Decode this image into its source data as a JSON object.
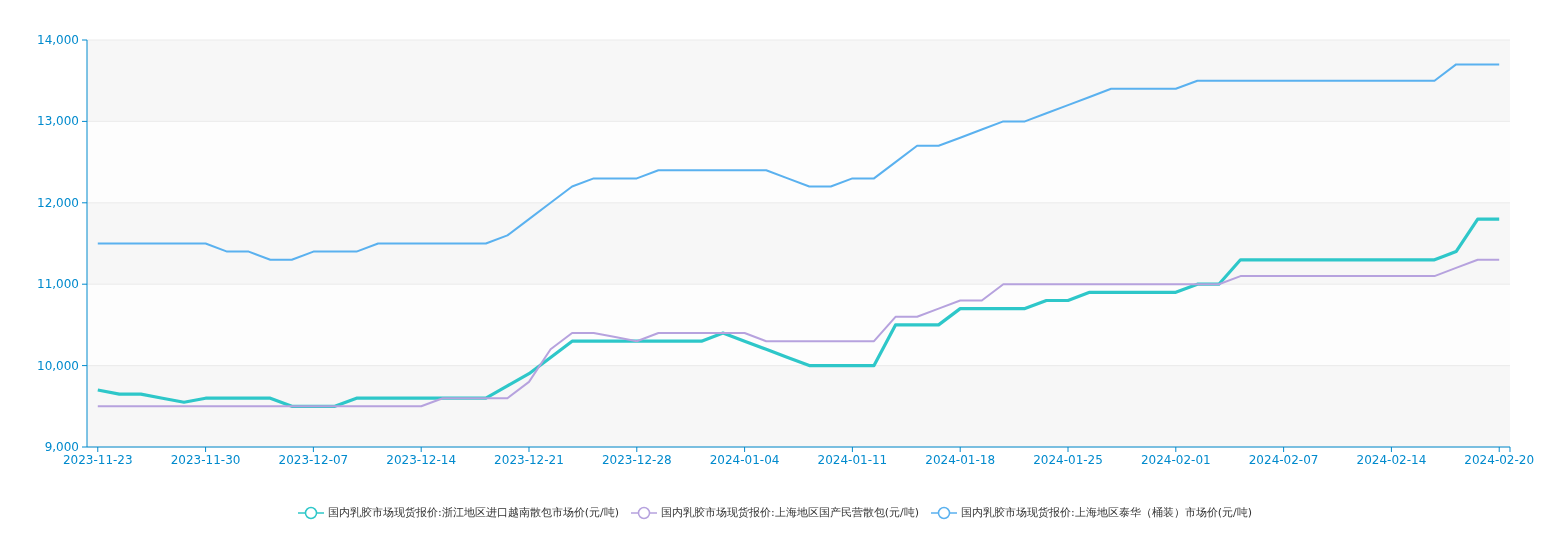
{
  "chart": {
    "chart_data": {
      "type": "line",
      "grid": true,
      "categories": [
        "2023-11-23",
        null,
        null,
        null,
        null,
        "2023-11-30",
        null,
        null,
        null,
        null,
        "2023-12-07",
        null,
        null,
        null,
        null,
        "2023-12-14",
        null,
        null,
        null,
        null,
        "2023-12-21",
        null,
        null,
        null,
        null,
        "2023-12-28",
        null,
        null,
        null,
        null,
        "2024-01-04",
        null,
        null,
        null,
        null,
        "2024-01-11",
        null,
        null,
        null,
        null,
        "2024-01-18",
        null,
        null,
        null,
        null,
        "2024-01-25",
        null,
        null,
        null,
        null,
        "2024-02-01",
        null,
        null,
        null,
        null,
        "2024-02-07",
        null,
        null,
        null,
        null,
        "2024-02-14",
        null,
        null,
        null,
        null,
        "2024-02-20"
      ],
      "series": [
        {
          "name": "国内乳胶市场现货报价:浙江地区进口越南散包市场价(元/吨)",
          "color": "#2ec7c9",
          "values": [
            9700,
            9650,
            9650,
            9600,
            9550,
            9600,
            9600,
            9600,
            9600,
            9500,
            9500,
            9500,
            9600,
            9600,
            9600,
            9600,
            9600,
            9600,
            9600,
            9750,
            9900,
            10100,
            10300,
            10300,
            10300,
            10300,
            10300,
            10300,
            10300,
            10400,
            10300,
            10200,
            10100,
            10000,
            10000,
            10000,
            10000,
            10500,
            10500,
            10500,
            10700,
            10700,
            10700,
            10700,
            10800,
            10800,
            10900,
            10900,
            10900,
            10900,
            10900,
            11000,
            11000,
            11300,
            11300,
            11300,
            11300,
            11300,
            11300,
            11300,
            11300,
            11300,
            11300,
            11400,
            11800,
            11800
          ]
        },
        {
          "name": "国内乳胶市场现货报价:上海地区国产民营散包(元/吨)",
          "color": "#b6a2de",
          "values": [
            9500,
            9500,
            9500,
            9500,
            9500,
            9500,
            9500,
            9500,
            9500,
            9500,
            9500,
            9500,
            9500,
            9500,
            9500,
            9500,
            9600,
            9600,
            9600,
            9600,
            9800,
            10200,
            10400,
            10400,
            10350,
            10300,
            10400,
            10400,
            10400,
            10400,
            10400,
            10300,
            10300,
            10300,
            10300,
            10300,
            10300,
            10600,
            10600,
            10700,
            10800,
            10800,
            11000,
            11000,
            11000,
            11000,
            11000,
            11000,
            11000,
            11000,
            11000,
            11000,
            11000,
            11100,
            11100,
            11100,
            11100,
            11100,
            11100,
            11100,
            11100,
            11100,
            11100,
            11200,
            11300,
            11300
          ]
        },
        {
          "name": "国内乳胶市场现货报价:上海地区泰华（桶装）市场价(元/吨)",
          "color": "#5ab1ef",
          "values": [
            11500,
            11500,
            11500,
            11500,
            11500,
            11500,
            11400,
            11400,
            11300,
            11300,
            11400,
            11400,
            11400,
            11500,
            11500,
            11500,
            11500,
            11500,
            11500,
            11600,
            11800,
            12000,
            12200,
            12300,
            12300,
            12300,
            12400,
            12400,
            12400,
            12400,
            12400,
            12400,
            12300,
            12200,
            12200,
            12300,
            12300,
            12500,
            12700,
            12700,
            12800,
            12900,
            13000,
            13000,
            13100,
            13200,
            13300,
            13400,
            13400,
            13400,
            13400,
            13500,
            13500,
            13500,
            13500,
            13500,
            13500,
            13500,
            13500,
            13500,
            13500,
            13500,
            13500,
            13700,
            13700,
            13700
          ]
        }
      ],
      "ylim": [
        9000,
        14000
      ],
      "yticks": [
        {
          "value": 9000,
          "label": "9,000"
        },
        {
          "value": 10000,
          "label": "10,000"
        },
        {
          "value": 11000,
          "label": "11,000"
        },
        {
          "value": 12000,
          "label": "12,000"
        },
        {
          "value": 13000,
          "label": "13,000"
        },
        {
          "value": 14000,
          "label": "14,000"
        }
      ]
    }
  }
}
